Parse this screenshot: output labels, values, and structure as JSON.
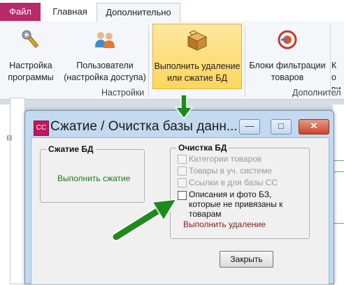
{
  "ribbon": {
    "tabs": [
      "Файл",
      "Главная",
      "Дополнительно"
    ],
    "buttons": [
      {
        "label": "Настройка программы",
        "icon": "wrench-icon"
      },
      {
        "label": "Пользователи (настройка доступа)",
        "icon": "users-icon"
      },
      {
        "label": "Выполнить удаление или сжатие БД",
        "icon": "box-icon"
      },
      {
        "label": "Блоки фильтрации товаров",
        "icon": "filter-block-icon"
      },
      {
        "label": "Ко ви"
      }
    ],
    "groups": [
      "Настройки",
      "Дополнител"
    ]
  },
  "dialog": {
    "title": "Сжатие / Очистка базы данн...",
    "app_icon_text": "CC",
    "compress": {
      "label": "Сжатие БД",
      "action": "Выполнить сжатие"
    },
    "cleanup": {
      "label": "Очистка БД",
      "options": [
        {
          "label": "Категории товаров",
          "enabled": false,
          "checked": false
        },
        {
          "label": "Товары в уч. системе",
          "enabled": false,
          "checked": false
        },
        {
          "label": "Ссылки в для базы СС",
          "enabled": false,
          "checked": false
        },
        {
          "label": "Описания и фото БЗ, которые не привязаны к товарам",
          "enabled": true,
          "checked": false
        }
      ],
      "action": "Выполнить удаление"
    },
    "close_button": "Закрыть",
    "window_buttons": {
      "minimize": "—",
      "maximize": "□",
      "close": "✕"
    }
  },
  "colors": {
    "file_tab": "#b82a68",
    "highlight": "#fbd65e",
    "arrow": "#1e8a1e",
    "link_green": "#1a7a1a",
    "link_red": "#8b1a1a"
  }
}
